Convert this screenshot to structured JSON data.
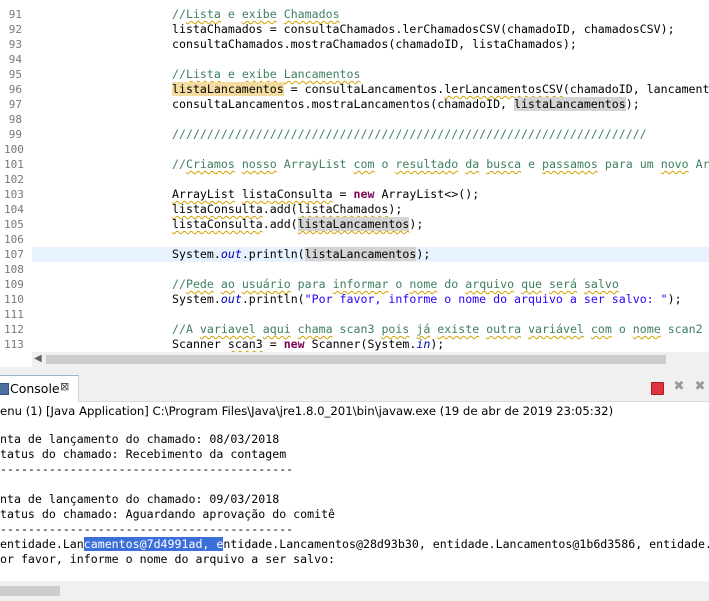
{
  "editor": {
    "lines": [
      {
        "n": "91",
        "segments": [
          {
            "t": "//",
            "c": "c"
          },
          {
            "t": "Lista",
            "c": "c wavy"
          },
          {
            "t": " e ",
            "c": "c"
          },
          {
            "t": "exibe",
            "c": "c wavy"
          },
          {
            "t": " ",
            "c": "c"
          },
          {
            "t": "Chamados",
            "c": "c wavy"
          }
        ]
      },
      {
        "n": "92",
        "segments": [
          {
            "t": "listaChamados = consultaChamados.",
            "c": ""
          },
          {
            "t": "lerChamadosCSV",
            "c": ""
          },
          {
            "t": "(chamadoID, chamadosCSV);",
            "c": ""
          }
        ]
      },
      {
        "n": "93",
        "segments": [
          {
            "t": "consultaChamados.mostraChamados(chamadoID, listaChamados);",
            "c": ""
          }
        ]
      },
      {
        "n": "94",
        "segments": []
      },
      {
        "n": "95",
        "segments": [
          {
            "t": "//",
            "c": "c"
          },
          {
            "t": "Lista",
            "c": "c wavy"
          },
          {
            "t": " e ",
            "c": "c"
          },
          {
            "t": "exibe",
            "c": "c wavy"
          },
          {
            "t": " ",
            "c": "c"
          },
          {
            "t": "Lancamentos",
            "c": "c wavy"
          }
        ]
      },
      {
        "n": "96",
        "segments": [
          {
            "t": "listaLancamentos",
            "c": "hl-var"
          },
          {
            "t": " = consultaLancamentos.",
            "c": ""
          },
          {
            "t": "lerLancamentosCSV",
            "c": "wavy"
          },
          {
            "t": "(chamadoID, lancament",
            "c": ""
          }
        ]
      },
      {
        "n": "97",
        "segments": [
          {
            "t": "consultaLancamentos.mostraLancamentos(chamadoID, ",
            "c": ""
          },
          {
            "t": "listaLancamentos",
            "c": "hl-ref"
          },
          {
            "t": ");",
            "c": ""
          }
        ]
      },
      {
        "n": "98",
        "segments": []
      },
      {
        "n": "99",
        "segments": [
          {
            "t": "////////////////////////////////////////////////////////////////////",
            "c": "c"
          }
        ]
      },
      {
        "n": "100",
        "segments": []
      },
      {
        "n": "101",
        "segments": [
          {
            "t": "//",
            "c": "c"
          },
          {
            "t": "Criamos",
            "c": "c wavy"
          },
          {
            "t": " ",
            "c": "c"
          },
          {
            "t": "nosso",
            "c": "c wavy"
          },
          {
            "t": " ArrayList ",
            "c": "c"
          },
          {
            "t": "com",
            "c": "c wavy"
          },
          {
            "t": " o ",
            "c": "c"
          },
          {
            "t": "resultado",
            "c": "c wavy"
          },
          {
            "t": " ",
            "c": "c"
          },
          {
            "t": "da",
            "c": "c wavy"
          },
          {
            "t": " ",
            "c": "c"
          },
          {
            "t": "busca",
            "c": "c wavy"
          },
          {
            "t": " e ",
            "c": "c"
          },
          {
            "t": "passamos",
            "c": "c wavy"
          },
          {
            "t": " para um ",
            "c": "c"
          },
          {
            "t": "novo",
            "c": "c wavy"
          },
          {
            "t": " Ar",
            "c": "c"
          }
        ]
      },
      {
        "n": "102",
        "segments": []
      },
      {
        "n": "103",
        "segments": [
          {
            "t": "ArrayList",
            "c": "wavy"
          },
          {
            "t": " ",
            "c": ""
          },
          {
            "t": "listaConsulta",
            "c": "wavy"
          },
          {
            "t": " = ",
            "c": ""
          },
          {
            "t": "new",
            "c": "kw"
          },
          {
            "t": " ArrayList<>();",
            "c": ""
          }
        ]
      },
      {
        "n": "104",
        "segments": [
          {
            "t": "listaConsulta",
            "c": "wavy"
          },
          {
            "t": ".add(",
            "c": ""
          },
          {
            "t": "listaChamados",
            "c": "wavy"
          },
          {
            "t": ");",
            "c": ""
          }
        ]
      },
      {
        "n": "105",
        "segments": [
          {
            "t": "listaConsulta",
            "c": "wavy"
          },
          {
            "t": ".add(",
            "c": ""
          },
          {
            "t": "listaLancamentos",
            "c": "hl-ref wavy"
          },
          {
            "t": ");",
            "c": ""
          }
        ]
      },
      {
        "n": "106",
        "segments": []
      },
      {
        "n": "107",
        "segments": [
          {
            "t": "System.",
            "c": ""
          },
          {
            "t": "out",
            "c": "fld"
          },
          {
            "t": ".println(",
            "c": ""
          },
          {
            "t": "listaLancamentos",
            "c": "hl-ref"
          },
          {
            "t": ");",
            "c": ""
          }
        ],
        "current": true
      },
      {
        "n": "108",
        "segments": []
      },
      {
        "n": "109",
        "segments": [
          {
            "t": "//",
            "c": "c"
          },
          {
            "t": "Pede",
            "c": "c wavy"
          },
          {
            "t": " ",
            "c": "c"
          },
          {
            "t": "ao",
            "c": "c wavy"
          },
          {
            "t": " ",
            "c": "c"
          },
          {
            "t": "usuário",
            "c": "c wavy"
          },
          {
            "t": " para ",
            "c": "c"
          },
          {
            "t": "informar",
            "c": "c wavy"
          },
          {
            "t": " o ",
            "c": "c"
          },
          {
            "t": "nome",
            "c": "c wavy"
          },
          {
            "t": " do ",
            "c": "c"
          },
          {
            "t": "arquivo",
            "c": "c wavy"
          },
          {
            "t": " ",
            "c": "c"
          },
          {
            "t": "que",
            "c": "c wavy"
          },
          {
            "t": " ",
            "c": "c"
          },
          {
            "t": "será",
            "c": "c wavy"
          },
          {
            "t": " ",
            "c": "c"
          },
          {
            "t": "salvo",
            "c": "c wavy"
          }
        ]
      },
      {
        "n": "110",
        "segments": [
          {
            "t": "System.",
            "c": ""
          },
          {
            "t": "out",
            "c": "fld"
          },
          {
            "t": ".println(",
            "c": ""
          },
          {
            "t": "\"Por favor, informe o nome do arquivo a ser salvo: \"",
            "c": "str"
          },
          {
            "t": ");",
            "c": ""
          }
        ]
      },
      {
        "n": "111",
        "segments": []
      },
      {
        "n": "112",
        "segments": [
          {
            "t": "//A ",
            "c": "c"
          },
          {
            "t": "variavel",
            "c": "c wavy"
          },
          {
            "t": " ",
            "c": "c"
          },
          {
            "t": "aqui",
            "c": "c wavy"
          },
          {
            "t": " ",
            "c": "c"
          },
          {
            "t": "chama",
            "c": "c wavy"
          },
          {
            "t": " scan3 ",
            "c": "c"
          },
          {
            "t": "pois",
            "c": "c wavy"
          },
          {
            "t": " ",
            "c": "c"
          },
          {
            "t": "já",
            "c": "c wavy"
          },
          {
            "t": " ",
            "c": "c"
          },
          {
            "t": "existe",
            "c": "c wavy"
          },
          {
            "t": " ",
            "c": "c"
          },
          {
            "t": "outra",
            "c": "c wavy"
          },
          {
            "t": " ",
            "c": "c"
          },
          {
            "t": "variável",
            "c": "c wavy"
          },
          {
            "t": " ",
            "c": "c"
          },
          {
            "t": "com",
            "c": "c wavy"
          },
          {
            "t": " o ",
            "c": "c"
          },
          {
            "t": "nome",
            "c": "c wavy"
          },
          {
            "t": " scan2",
            "c": "c"
          }
        ]
      },
      {
        "n": "113",
        "segments": [
          {
            "t": "Scanner ",
            "c": ""
          },
          {
            "t": "scan3",
            "c": "wavy"
          },
          {
            "t": " = ",
            "c": ""
          },
          {
            "t": "new",
            "c": "kw"
          },
          {
            "t": " Scanner(System.",
            "c": ""
          },
          {
            "t": "in",
            "c": "fld"
          },
          {
            "t": ");",
            "c": ""
          }
        ]
      }
    ]
  },
  "console": {
    "tab_label": "Console",
    "tab_close": "⊠",
    "launch_info": "enu (1) [Java Application] C:\\Program Files\\Java\\jre1.8.0_201\\bin\\javaw.exe (19 de abr de 2019 23:05:32)",
    "output": [
      {
        "segments": [
          {
            "t": "nta de lançamento do chamado: 08/03/2018"
          }
        ]
      },
      {
        "segments": [
          {
            "t": "tatus do chamado: Recebimento da contagem"
          }
        ]
      },
      {
        "segments": [
          {
            "t": "------------------------------------------"
          }
        ]
      },
      {
        "segments": []
      },
      {
        "segments": [
          {
            "t": "nta de lançamento do chamado: 09/03/2018"
          }
        ]
      },
      {
        "segments": [
          {
            "t": "tatus do chamado: Aguardando aprovação do comitê"
          }
        ]
      },
      {
        "segments": [
          {
            "t": "------------------------------------------"
          }
        ]
      },
      {
        "segments": [
          {
            "t": "entidade.Lan"
          },
          {
            "t": "camentos@7d4991ad, e",
            "sel": true
          },
          {
            "t": "ntidade.Lancamentos@28d93b30, entidade.Lancamentos@1b6d3586, entidade."
          }
        ]
      },
      {
        "segments": [
          {
            "t": "or favor, informe o nome do arquivo a ser salvo:"
          }
        ]
      }
    ]
  },
  "icons": {
    "scroll_left": "◀",
    "remove_launch": "✖",
    "remove_all": "✖"
  }
}
